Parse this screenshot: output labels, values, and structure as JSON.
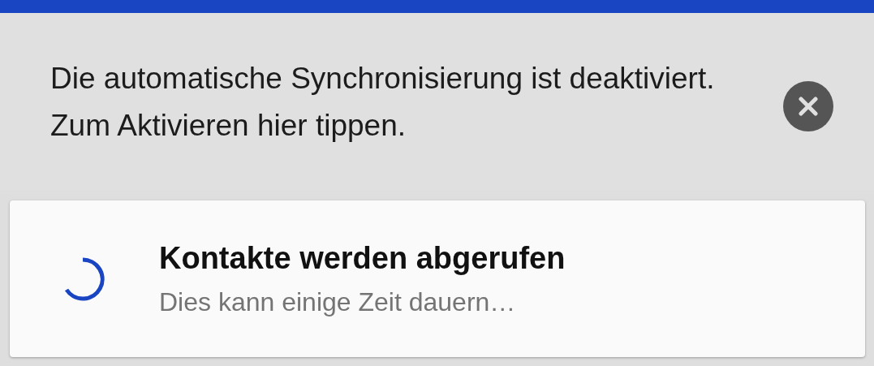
{
  "sync_banner": {
    "message": "Die automatische Synchronisierung ist deaktiviert. Zum Aktivieren hier tippen."
  },
  "loading_card": {
    "title": "Kontakte werden abgerufen",
    "subtitle": "Dies kann einige Zeit dauern…"
  }
}
